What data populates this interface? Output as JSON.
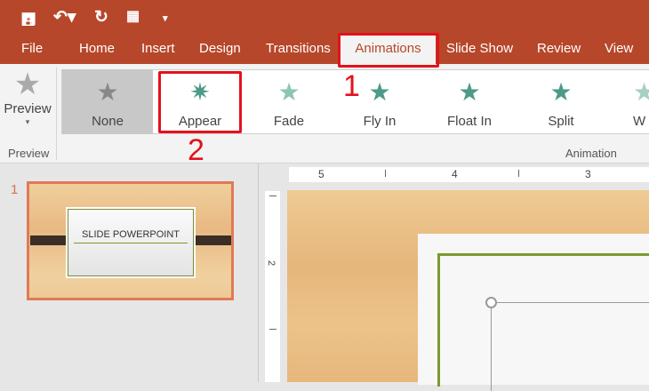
{
  "quick_access": {
    "save_icon": "save-icon",
    "undo_icon": "undo-icon",
    "redo_icon": "repeat-icon",
    "present_icon": "presentation-icon",
    "customize_icon": "customize-icon"
  },
  "tabs": [
    {
      "label": "File"
    },
    {
      "label": "Home"
    },
    {
      "label": "Insert"
    },
    {
      "label": "Design"
    },
    {
      "label": "Transitions"
    },
    {
      "label": "Animations",
      "active": true
    },
    {
      "label": "Slide Show"
    },
    {
      "label": "Review"
    },
    {
      "label": "View"
    }
  ],
  "preview": {
    "label": "Preview",
    "group": "Preview"
  },
  "animations": [
    {
      "label": "None"
    },
    {
      "label": "Appear"
    },
    {
      "label": "Fade"
    },
    {
      "label": "Fly In"
    },
    {
      "label": "Float In"
    },
    {
      "label": "Split"
    },
    {
      "label": "W"
    }
  ],
  "animation_group": "Animation",
  "annotations": {
    "step1": "1",
    "step2": "2"
  },
  "slides": [
    {
      "number": "1",
      "title": "SLIDE POWERPOINT"
    }
  ],
  "ruler": {
    "top": [
      "5",
      "4",
      "3"
    ],
    "left": [
      "2"
    ]
  },
  "colors": {
    "accent": "#b7472a",
    "highlight": "#e3121b",
    "animation_icon": "#4c9a87"
  }
}
